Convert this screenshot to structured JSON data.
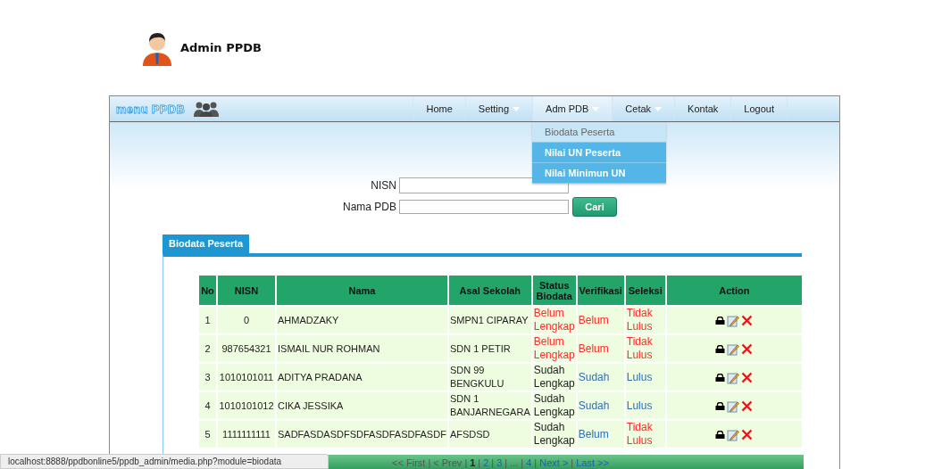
{
  "header": {
    "title": "Admin PPDB"
  },
  "nav": {
    "brand": "menu PPDB",
    "items": [
      {
        "label": "Home",
        "dropdown": false,
        "expanded": false
      },
      {
        "label": "Setting",
        "dropdown": true,
        "expanded": false
      },
      {
        "label": "Adm PDB",
        "dropdown": true,
        "expanded": true,
        "submenu": [
          {
            "label": "Biodata Peserta",
            "selected": true
          },
          {
            "label": "Nilai UN Peserta",
            "selected": false
          },
          {
            "label": "Nilai Minimun UN",
            "selected": false
          }
        ]
      },
      {
        "label": "Cetak",
        "dropdown": true,
        "expanded": false
      },
      {
        "label": "Kontak",
        "dropdown": false,
        "expanded": false
      },
      {
        "label": "Logout",
        "dropdown": false,
        "expanded": false
      }
    ]
  },
  "search": {
    "fields": [
      {
        "label": "NISN"
      },
      {
        "label": "Nama PDB"
      }
    ],
    "button": "Cari"
  },
  "panel": {
    "tab": "Biodata Peserta"
  },
  "table": {
    "columns": [
      "No",
      "NISN",
      "Nama",
      "Asal Sekolah",
      "Status Biodata",
      "Verifikasi",
      "Seleksi",
      "Action"
    ],
    "rows": [
      {
        "no": "1",
        "nisn": "0",
        "nama": "AHMADZAKY",
        "asal": "SMPN1 CIPARAY",
        "status": {
          "text": "Belum Lengkap",
          "color": "#ff2a2a"
        },
        "verifikasi": {
          "text": "Belum",
          "color": "#ff2a2a"
        },
        "seleksi": {
          "text": "Tidak Lulus",
          "color": "#ff2a2a"
        }
      },
      {
        "no": "2",
        "nisn": "987654321",
        "nama": "ISMAIL NUR ROHMAN",
        "asal": "SDN 1 PETIR",
        "status": {
          "text": "Belum Lengkap",
          "color": "#ff2a2a"
        },
        "verifikasi": {
          "text": "Belum",
          "color": "#ff2a2a"
        },
        "seleksi": {
          "text": "Tidak Lulus",
          "color": "#ff2a2a"
        }
      },
      {
        "no": "3",
        "nisn": "1010101011",
        "nama": "ADITYA PRADANA",
        "asal": "SDN 99 BENGKULU",
        "status": {
          "text": "Sudah Lengkap",
          "color": "#222222"
        },
        "verifikasi": {
          "text": "Sudah",
          "color": "#2f6fb5"
        },
        "seleksi": {
          "text": "Lulus",
          "color": "#2f6fb5"
        }
      },
      {
        "no": "4",
        "nisn": "1010101012",
        "nama": "CIKA JESSIKA",
        "asal": "SDN 1 BANJARNEGARA",
        "status": {
          "text": "Sudah Lengkap",
          "color": "#222222"
        },
        "verifikasi": {
          "text": "Sudah",
          "color": "#2f6fb5"
        },
        "seleksi": {
          "text": "Lulus",
          "color": "#2f6fb5"
        }
      },
      {
        "no": "5",
        "nisn": "1111111111",
        "nama": "SADFASDASDFSDFASDFASDFASDF",
        "asal": "AFSDSD",
        "status": {
          "text": "Sudah Lengkap",
          "color": "#222222"
        },
        "verifikasi": {
          "text": "Belum",
          "color": "#2f6fb5"
        },
        "seleksi": {
          "text": "Tidak Lulus",
          "color": "#ff2a2a"
        }
      }
    ]
  },
  "pagination_separator": "|",
  "pagination": [
    {
      "label": "<< First",
      "kind": "disabled"
    },
    {
      "label": "< Prev",
      "kind": "disabled"
    },
    {
      "label": "1",
      "kind": "current"
    },
    {
      "label": "2",
      "kind": "link"
    },
    {
      "label": "3",
      "kind": "link"
    },
    {
      "label": "...",
      "kind": "disabled"
    },
    {
      "label": "4",
      "kind": "link"
    },
    {
      "label": "Next >",
      "kind": "link"
    },
    {
      "label": "Last >>",
      "kind": "link"
    }
  ],
  "status_bar": {
    "url": "localhost:8888/ppdbonline5/ppdb_admin/media.php?module=biodata"
  }
}
